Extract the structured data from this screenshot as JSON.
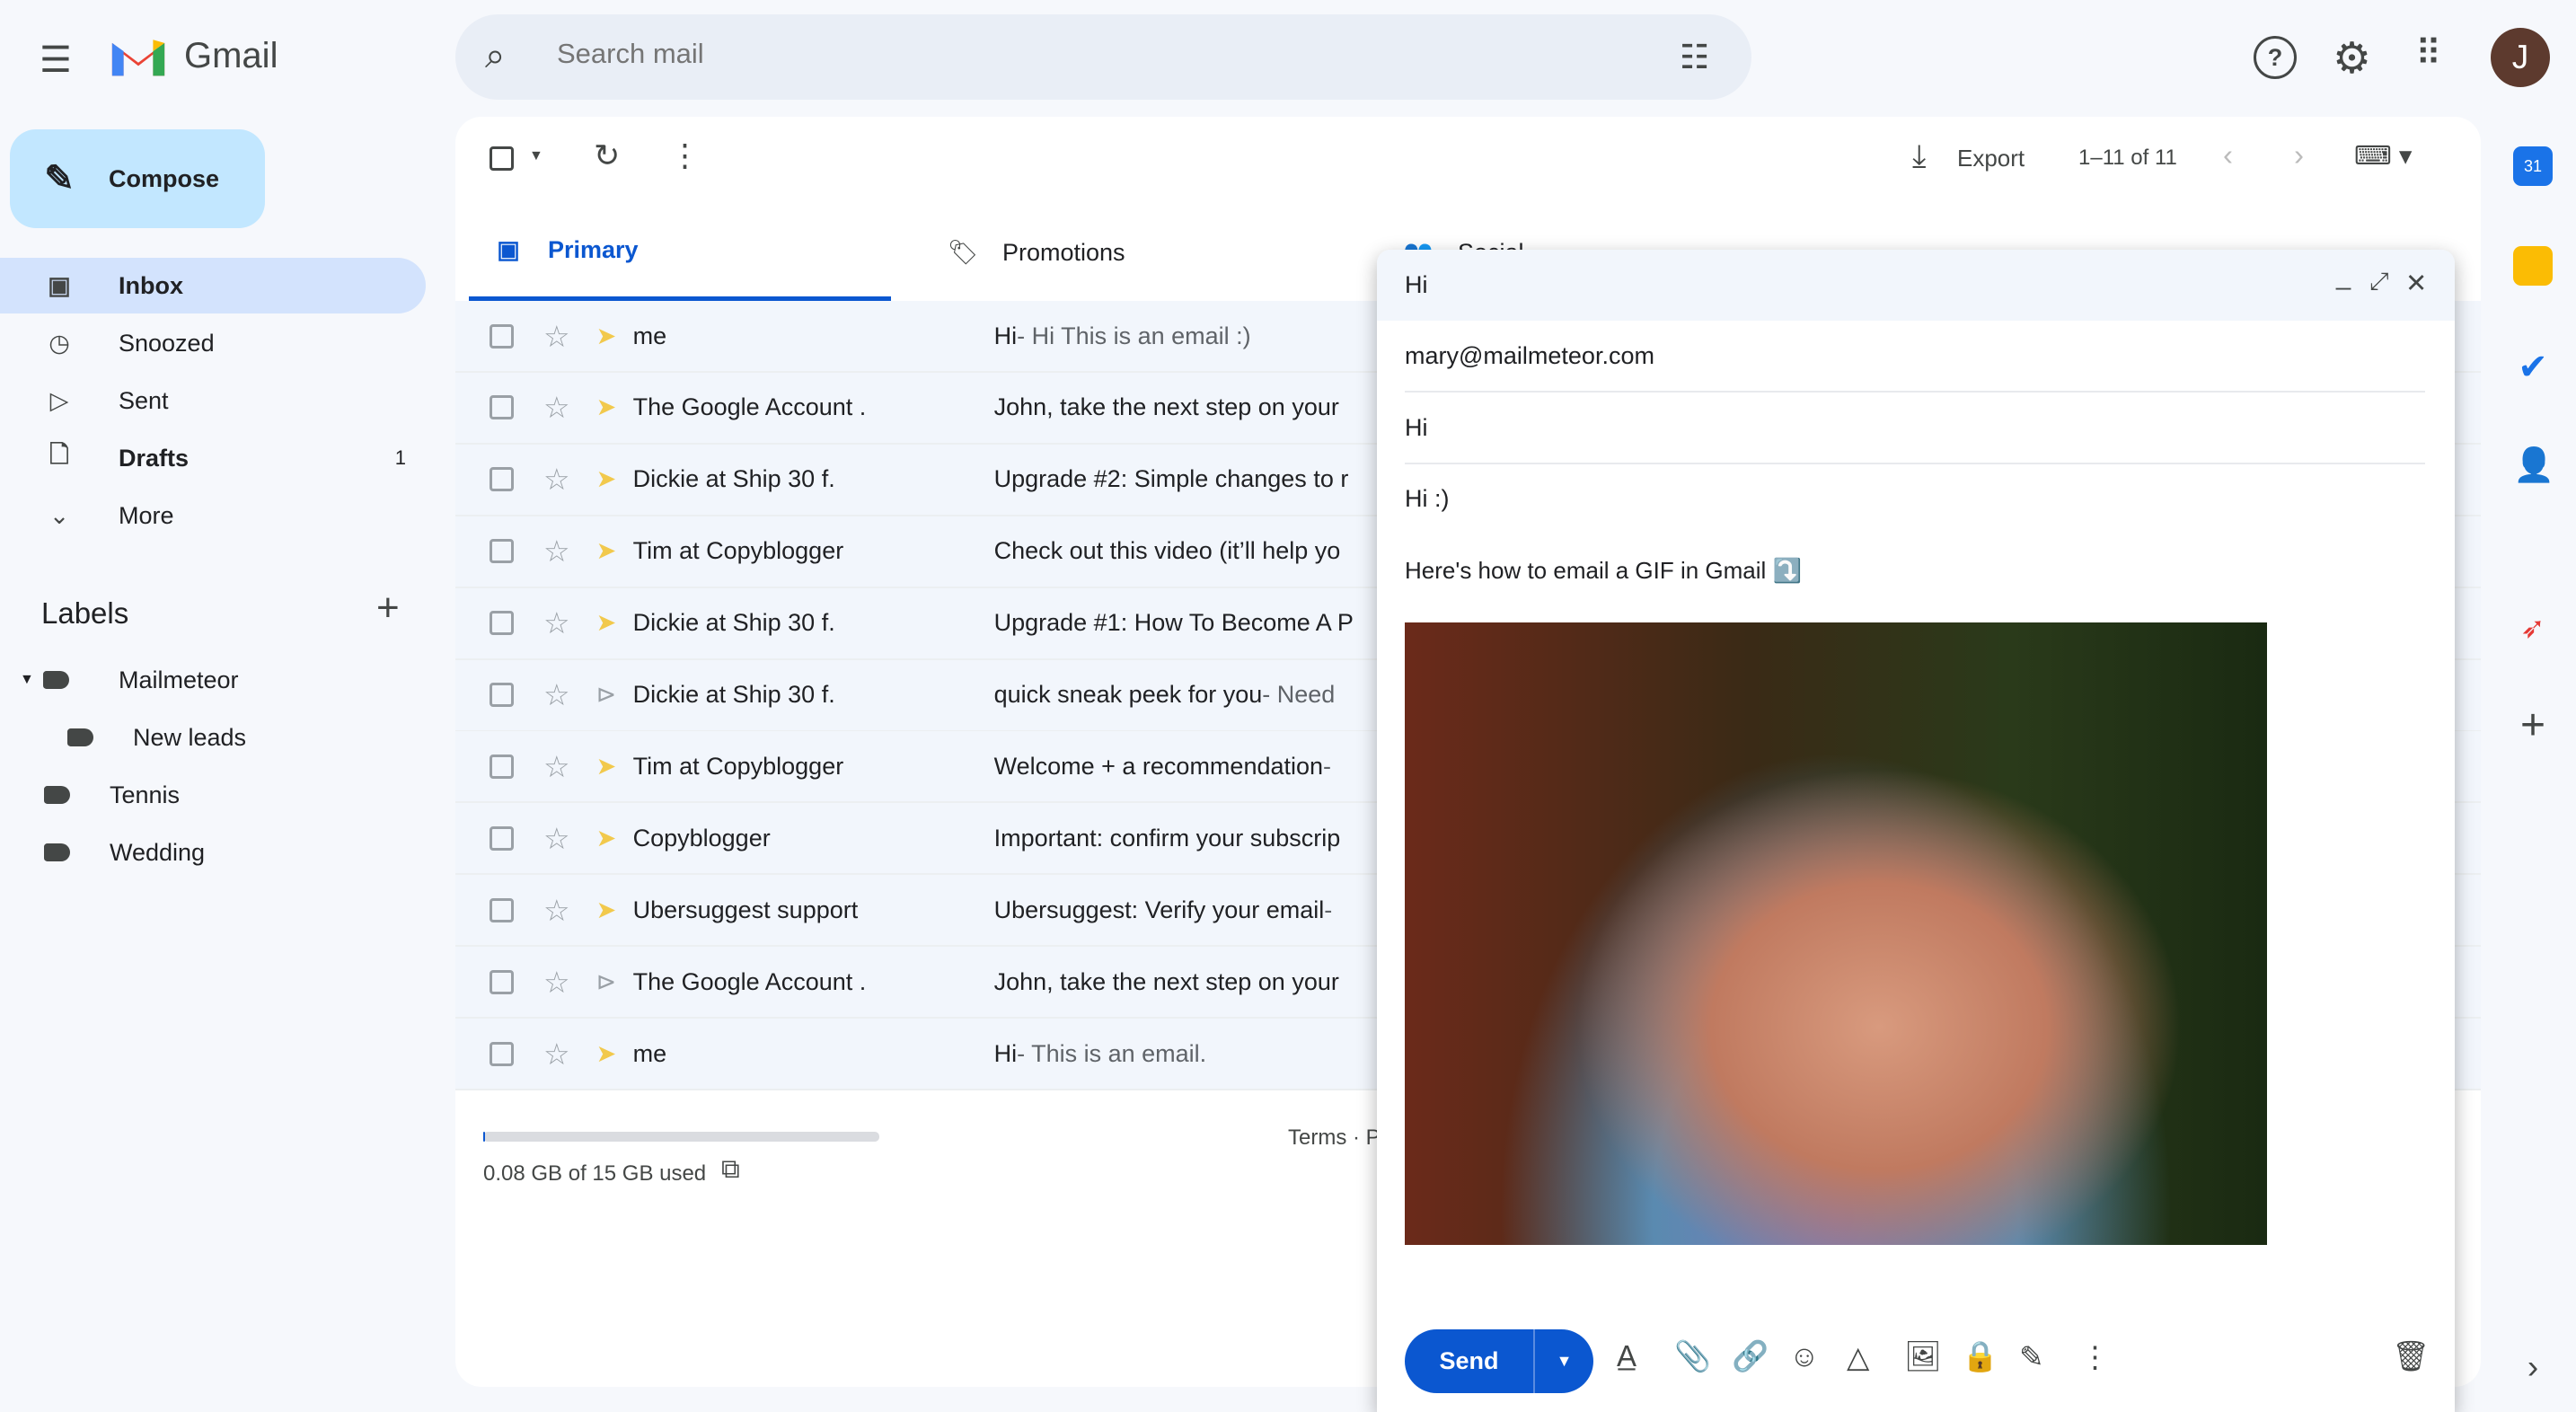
{
  "app": {
    "name": "Gmail",
    "avatar_letter": "J"
  },
  "search": {
    "placeholder": "Search mail"
  },
  "compose_button": "Compose",
  "nav": [
    {
      "label": "Inbox",
      "count": ""
    },
    {
      "label": "Snoozed",
      "count": ""
    },
    {
      "label": "Sent",
      "count": ""
    },
    {
      "label": "Drafts",
      "count": "1"
    },
    {
      "label": "More",
      "count": ""
    }
  ],
  "labels": {
    "title": "Labels",
    "items": [
      "Mailmeteor",
      "New leads",
      "Tennis",
      "Wedding"
    ]
  },
  "toolbar": {
    "export": "Export",
    "pagination": "1–11 of 11"
  },
  "tabs": [
    {
      "label": "Primary"
    },
    {
      "label": "Promotions"
    },
    {
      "label": "Social"
    }
  ],
  "emails": [
    {
      "sender": "me",
      "subject": "Hi",
      "snippet": " - Hi This is an email :)",
      "important": true
    },
    {
      "sender": "The Google Account .",
      "subject": "John, take the next step on your",
      "snippet": "",
      "important": true
    },
    {
      "sender": "Dickie at Ship 30 f.",
      "subject": "Upgrade #2: Simple changes to r",
      "snippet": "",
      "important": true
    },
    {
      "sender": "Tim at Copyblogger",
      "subject": "Check out this video (it’ll help yo",
      "snippet": "",
      "important": true
    },
    {
      "sender": "Dickie at Ship 30 f.",
      "subject": "Upgrade #1: How To Become A P",
      "snippet": "",
      "important": true
    },
    {
      "sender": "Dickie at Ship 30 f.",
      "subject": "quick sneak peek for you",
      "snippet": " - Need",
      "important": false
    },
    {
      "sender": "Tim at Copyblogger",
      "subject": "Welcome + a recommendation",
      "snippet": " -",
      "important": true
    },
    {
      "sender": "Copyblogger",
      "subject": "Important: confirm your subscrip",
      "snippet": "",
      "important": true
    },
    {
      "sender": "Ubersuggest support",
      "subject": "Ubersuggest: Verify your email",
      "snippet": " -",
      "important": true
    },
    {
      "sender": "The Google Account .",
      "subject": "John, take the next step on your",
      "snippet": "",
      "important": false
    },
    {
      "sender": "me",
      "subject": "Hi",
      "snippet": " - This is an email.",
      "important": true
    }
  ],
  "footer": {
    "storage": "0.08 GB of 15 GB used",
    "storage_fraction": 0.005,
    "terms": "Terms · P"
  },
  "compose": {
    "title": "Hi",
    "to": "mary@mailmeteor.com",
    "subject": "Hi",
    "body_line1": "Hi :)",
    "body_line2": "Here's how to email a GIF in Gmail ⤵️",
    "send": "Send"
  },
  "colors": {
    "accent": "#0b57d0",
    "compose_bg": "#c2e7ff",
    "active_nav": "#d3e3fd",
    "important": "#f2c94c"
  }
}
